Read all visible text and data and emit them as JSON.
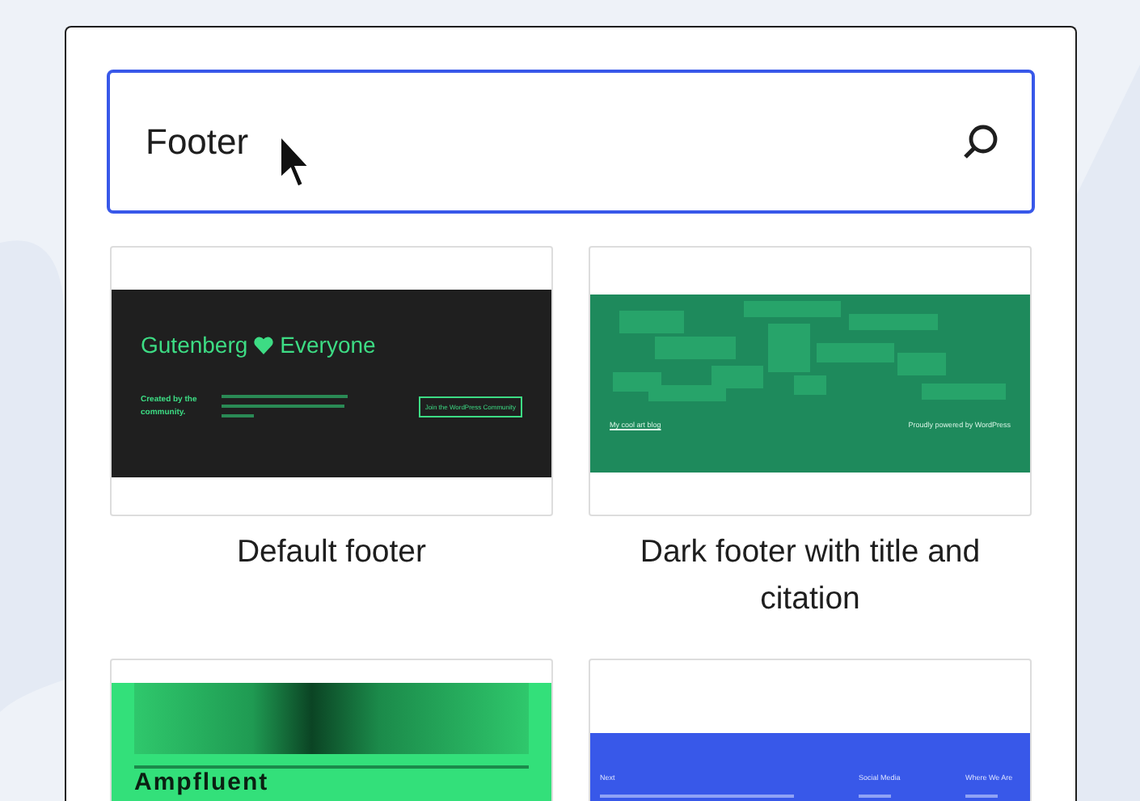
{
  "search": {
    "value": "Footer"
  },
  "patterns": [
    {
      "kind": "gutenberg",
      "heading": "Gutenberg",
      "heading_end": "Everyone",
      "credit": "Created by the community.",
      "button": "Join the WordPress Community",
      "title": "Default footer"
    },
    {
      "kind": "art",
      "site": "My cool art blog",
      "powered": "Proudly powered by WordPress",
      "title": "Dark footer with title and citation"
    },
    {
      "kind": "gradient",
      "brand": "Ampfluent"
    },
    {
      "kind": "columns",
      "columns": [
        "Next",
        "Social Media",
        "Where We Are"
      ]
    }
  ]
}
